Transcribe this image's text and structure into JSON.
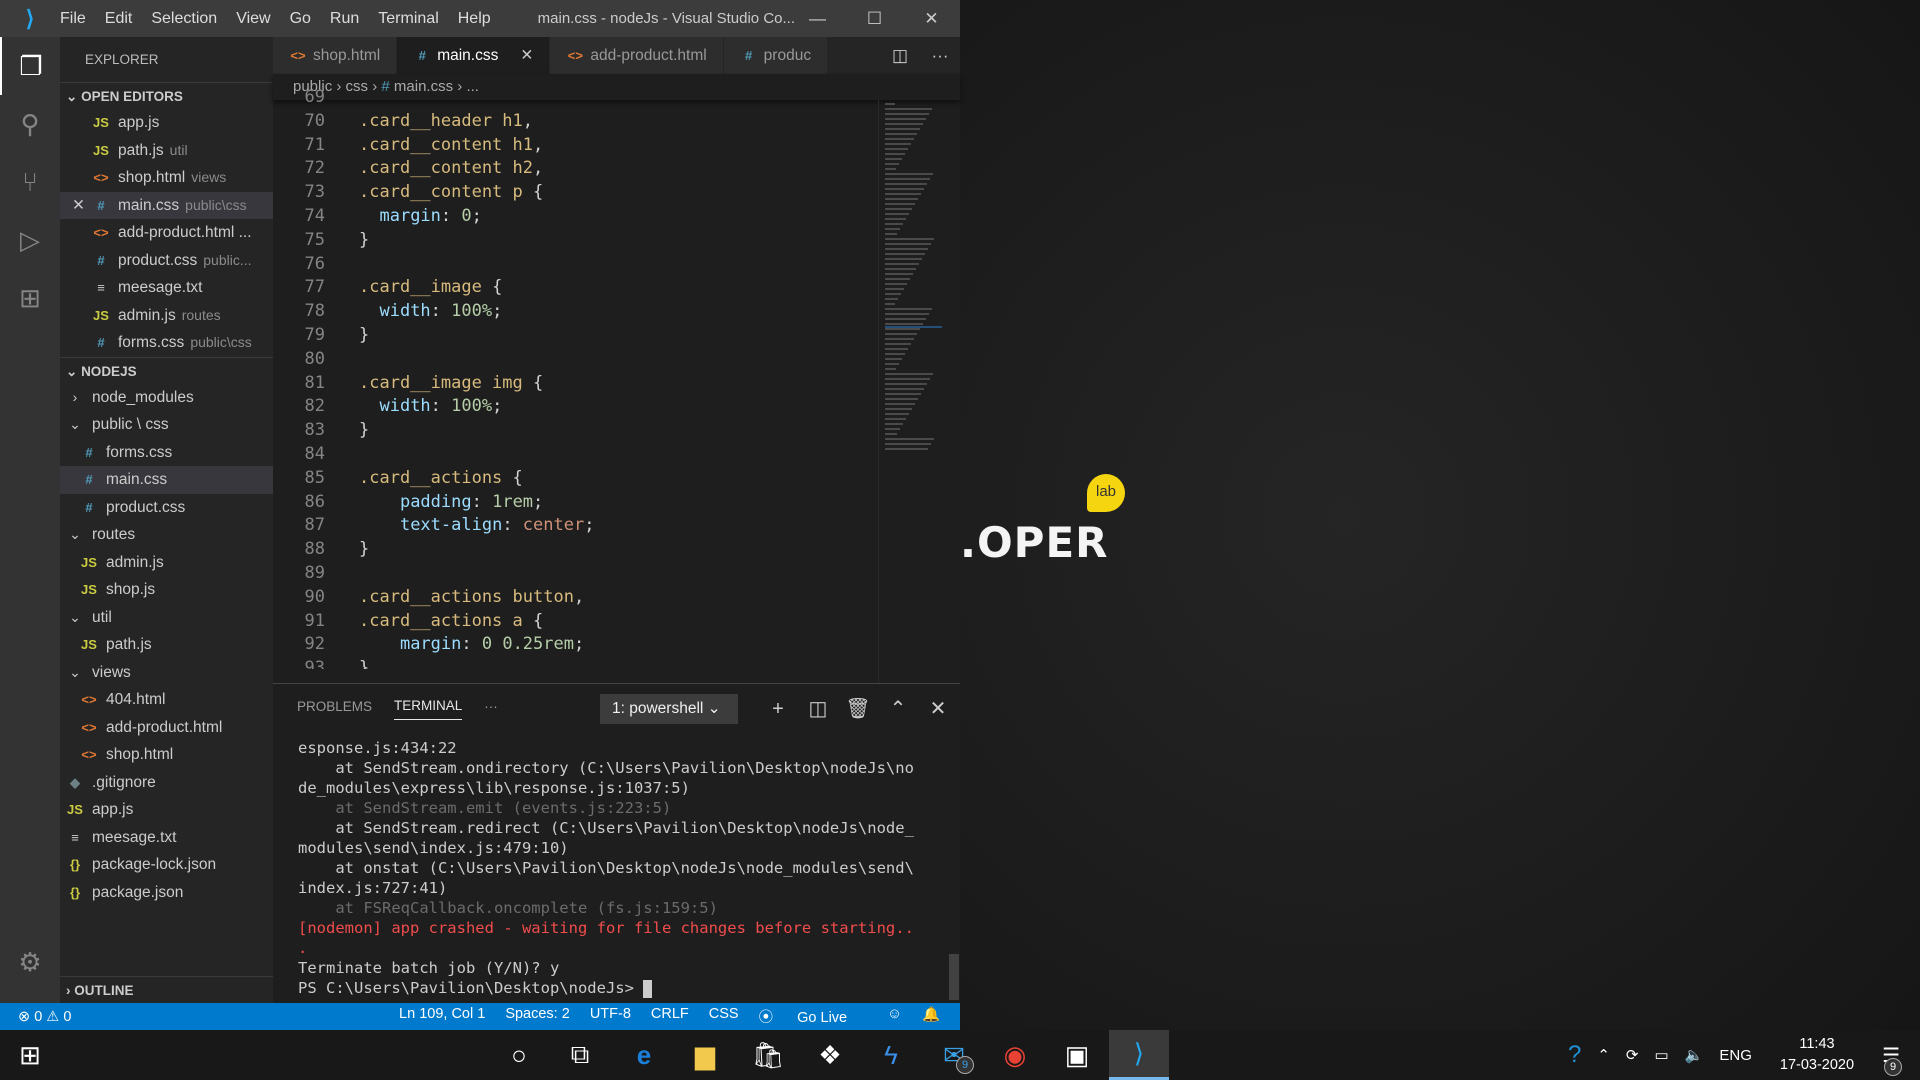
{
  "window": {
    "title": "main.css - nodeJs - Visual Studio Co...",
    "menu": [
      "File",
      "Edit",
      "Selection",
      "View",
      "Go",
      "Run",
      "Terminal",
      "Help"
    ],
    "controls": [
      "—",
      "☐",
      "✕"
    ]
  },
  "activity_bar": {
    "items": [
      "explorer-icon",
      "search-icon",
      "source-control-icon",
      "run-debug-icon",
      "extensions-icon",
      "gear-icon"
    ]
  },
  "sidebar": {
    "header": "EXPLORER",
    "open_editors": {
      "title": "OPEN EDITORS",
      "items": [
        {
          "name": "app.js",
          "desc": "",
          "type": "js"
        },
        {
          "name": "path.js",
          "desc": "util",
          "type": "js"
        },
        {
          "name": "shop.html",
          "desc": "views",
          "type": "html"
        },
        {
          "name": "main.css",
          "desc": "public\\css",
          "type": "css",
          "active": true
        },
        {
          "name": "add-product.html ...",
          "desc": "",
          "type": "html"
        },
        {
          "name": "product.css",
          "desc": "public...",
          "type": "css"
        },
        {
          "name": "meesage.txt",
          "desc": "",
          "type": "txt"
        },
        {
          "name": "admin.js",
          "desc": "routes",
          "type": "js"
        },
        {
          "name": "forms.css",
          "desc": "public\\css",
          "type": "css"
        }
      ]
    },
    "project": {
      "title": "NODEJS",
      "items": [
        {
          "name": "node_modules",
          "type": "folder-closed",
          "depth": 1
        },
        {
          "name": "public \\ css",
          "type": "folder-open",
          "depth": 1
        },
        {
          "name": "forms.css",
          "type": "css",
          "depth": 2
        },
        {
          "name": "main.css",
          "type": "css",
          "depth": 2,
          "active": true
        },
        {
          "name": "product.css",
          "type": "css",
          "depth": 2
        },
        {
          "name": "routes",
          "type": "folder-open",
          "depth": 1
        },
        {
          "name": "admin.js",
          "type": "js",
          "depth": 2
        },
        {
          "name": "shop.js",
          "type": "js",
          "depth": 2
        },
        {
          "name": "util",
          "type": "folder-open",
          "depth": 1
        },
        {
          "name": "path.js",
          "type": "js",
          "depth": 2
        },
        {
          "name": "views",
          "type": "folder-open",
          "depth": 1
        },
        {
          "name": "404.html",
          "type": "html",
          "depth": 2
        },
        {
          "name": "add-product.html",
          "type": "html",
          "depth": 2
        },
        {
          "name": "shop.html",
          "type": "html",
          "depth": 2
        },
        {
          "name": ".gitignore",
          "type": "git",
          "depth": 1
        },
        {
          "name": "app.js",
          "type": "js",
          "depth": 1
        },
        {
          "name": "meesage.txt",
          "type": "txt",
          "depth": 1
        },
        {
          "name": "package-lock.json",
          "type": "json",
          "depth": 1
        },
        {
          "name": "package.json",
          "type": "json",
          "depth": 1
        }
      ]
    },
    "outline": "OUTLINE"
  },
  "tabs": [
    {
      "label": "shop.html",
      "type": "html"
    },
    {
      "label": "main.css",
      "type": "css",
      "active": true
    },
    {
      "label": "add-product.html",
      "type": "html"
    },
    {
      "label": "produc",
      "type": "css"
    }
  ],
  "breadcrumb": [
    "public",
    "css",
    "main.css",
    "..."
  ],
  "code": [
    {
      "n": "69",
      "t": []
    },
    {
      "n": "70",
      "t": [
        [
          "sel-t",
          ".card__header h1"
        ],
        [
          "pun",
          ","
        ]
      ]
    },
    {
      "n": "71",
      "t": [
        [
          "sel-t",
          ".card__content h1"
        ],
        [
          "pun",
          ","
        ]
      ]
    },
    {
      "n": "72",
      "t": [
        [
          "sel-t",
          ".card__content h2"
        ],
        [
          "pun",
          ","
        ]
      ]
    },
    {
      "n": "73",
      "t": [
        [
          "sel-t",
          ".card__content p "
        ],
        [
          "pun",
          "{"
        ]
      ]
    },
    {
      "n": "74",
      "t": [
        [
          "pun",
          "  "
        ],
        [
          "prop",
          "margin"
        ],
        [
          "pun",
          ": "
        ],
        [
          "num",
          "0"
        ],
        [
          "pun",
          ";"
        ]
      ]
    },
    {
      "n": "75",
      "t": [
        [
          "pun",
          "}"
        ]
      ]
    },
    {
      "n": "76",
      "t": []
    },
    {
      "n": "77",
      "t": [
        [
          "sel-t",
          ".card__image "
        ],
        [
          "pun",
          "{"
        ]
      ]
    },
    {
      "n": "78",
      "t": [
        [
          "pun",
          "  "
        ],
        [
          "prop",
          "width"
        ],
        [
          "pun",
          ": "
        ],
        [
          "num",
          "100%"
        ],
        [
          "pun",
          ";"
        ]
      ]
    },
    {
      "n": "79",
      "t": [
        [
          "pun",
          "}"
        ]
      ]
    },
    {
      "n": "80",
      "t": []
    },
    {
      "n": "81",
      "t": [
        [
          "sel-t",
          ".card__image img "
        ],
        [
          "pun",
          "{"
        ]
      ]
    },
    {
      "n": "82",
      "t": [
        [
          "pun",
          "  "
        ],
        [
          "prop",
          "width"
        ],
        [
          "pun",
          ": "
        ],
        [
          "num",
          "100%"
        ],
        [
          "pun",
          ";"
        ]
      ]
    },
    {
      "n": "83",
      "t": [
        [
          "pun",
          "}"
        ]
      ]
    },
    {
      "n": "84",
      "t": []
    },
    {
      "n": "85",
      "t": [
        [
          "sel-t",
          ".card__actions "
        ],
        [
          "pun",
          "{"
        ]
      ]
    },
    {
      "n": "86",
      "t": [
        [
          "pun",
          "    "
        ],
        [
          "prop",
          "padding"
        ],
        [
          "pun",
          ": "
        ],
        [
          "num",
          "1rem"
        ],
        [
          "pun",
          ";"
        ]
      ]
    },
    {
      "n": "87",
      "t": [
        [
          "pun",
          "    "
        ],
        [
          "prop",
          "text-align"
        ],
        [
          "pun",
          ": "
        ],
        [
          "val",
          "center"
        ],
        [
          "pun",
          ";"
        ]
      ]
    },
    {
      "n": "88",
      "t": [
        [
          "pun",
          "}"
        ]
      ]
    },
    {
      "n": "89",
      "t": []
    },
    {
      "n": "90",
      "t": [
        [
          "sel-t",
          ".card__actions button"
        ],
        [
          "pun",
          ","
        ]
      ]
    },
    {
      "n": "91",
      "t": [
        [
          "sel-t",
          ".card__actions a "
        ],
        [
          "pun",
          "{"
        ]
      ]
    },
    {
      "n": "92",
      "t": [
        [
          "pun",
          "    "
        ],
        [
          "prop",
          "margin"
        ],
        [
          "pun",
          ": "
        ],
        [
          "num",
          "0 0.25rem"
        ],
        [
          "pun",
          ";"
        ]
      ]
    },
    {
      "n": "93",
      "t": [
        [
          "pun",
          "}"
        ]
      ]
    }
  ],
  "panel": {
    "tabs": [
      "PROBLEMS",
      "TERMINAL",
      "···"
    ],
    "active_tab": "TERMINAL",
    "shell": "1: powershell",
    "lines": [
      {
        "c": "n",
        "t": "esponse.js:434:22"
      },
      {
        "c": "n",
        "t": "    at SendStream.ondirectory (C:\\Users\\Pavilion\\Desktop\\nodeJs\\no"
      },
      {
        "c": "n",
        "t": "de_modules\\express\\lib\\response.js:1037:5)"
      },
      {
        "c": "d",
        "t": "    at SendStream.emit (events.js:223:5)"
      },
      {
        "c": "n",
        "t": "    at SendStream.redirect (C:\\Users\\Pavilion\\Desktop\\nodeJs\\node_"
      },
      {
        "c": "n",
        "t": "modules\\send\\index.js:479:10)"
      },
      {
        "c": "n",
        "t": "    at onstat (C:\\Users\\Pavilion\\Desktop\\nodeJs\\node_modules\\send\\"
      },
      {
        "c": "n",
        "t": "index.js:727:41)"
      },
      {
        "c": "d",
        "t": "    at FSReqCallback.oncomplete (fs.js:159:5)"
      },
      {
        "c": "r",
        "t": "[nodemon] app crashed - waiting for file changes before starting.."
      },
      {
        "c": "r",
        "t": "."
      },
      {
        "c": "n",
        "t": "Terminate batch job (Y/N)? y"
      }
    ],
    "prompt": "PS C:\\Users\\Pavilion\\Desktop\\nodeJs> "
  },
  "status": {
    "errors": "0",
    "warnings": "0",
    "position": "Ln 109, Col 1",
    "spaces": "Spaces: 2",
    "encoding": "UTF-8",
    "eol": "CRLF",
    "language": "CSS",
    "golive": "Go Live"
  },
  "desktop": {
    "logo_text": ".OPER",
    "logo_bubble": "lab"
  },
  "taskbar": {
    "apps": [
      "windows-start",
      "cortana",
      "task-view",
      "edge",
      "file-explorer",
      "store",
      "dropbox",
      "visual-studio",
      "mail",
      "chrome",
      "app",
      "vscode"
    ],
    "mail_badge": "9",
    "tray": {
      "language": "ENG",
      "time": "11:43",
      "date": "17-03-2020",
      "notifications": "9"
    }
  }
}
